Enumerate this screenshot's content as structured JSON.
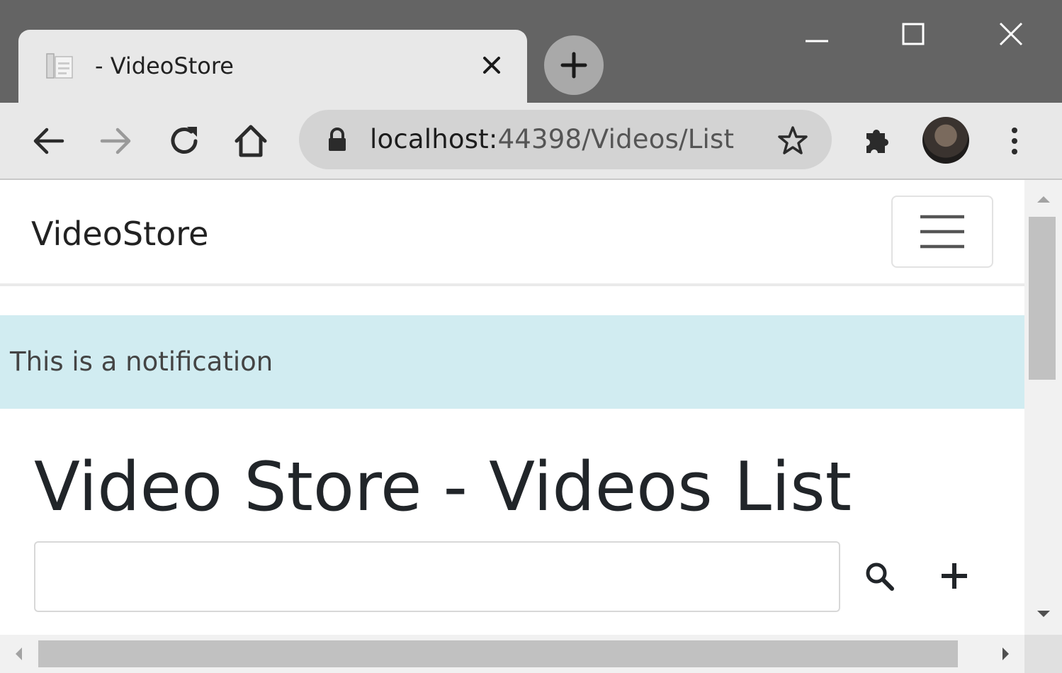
{
  "window": {
    "tab_title": "- VideoStore",
    "controls": [
      "minimize-icon",
      "maximize-icon",
      "close-icon"
    ]
  },
  "toolbar": {
    "url_host": "localhost:",
    "url_rest": "44398/Videos/List",
    "icons": [
      "back-arrow-icon",
      "forward-arrow-icon",
      "reload-icon",
      "home-icon",
      "lock-icon",
      "star-icon",
      "extensions-icon",
      "profile-avatar",
      "kebab-menu-icon"
    ]
  },
  "page": {
    "brand": "VideoStore",
    "notification": "This is a notification",
    "title": "Video Store - Videos List",
    "search": {
      "value": "",
      "placeholder": ""
    }
  },
  "colors": {
    "titlebar": "#646464",
    "toolbar": "#e8e8e8",
    "omnibox": "#d3d3d3",
    "alert_bg": "#d1ecf1",
    "heading_text": "#212529"
  }
}
